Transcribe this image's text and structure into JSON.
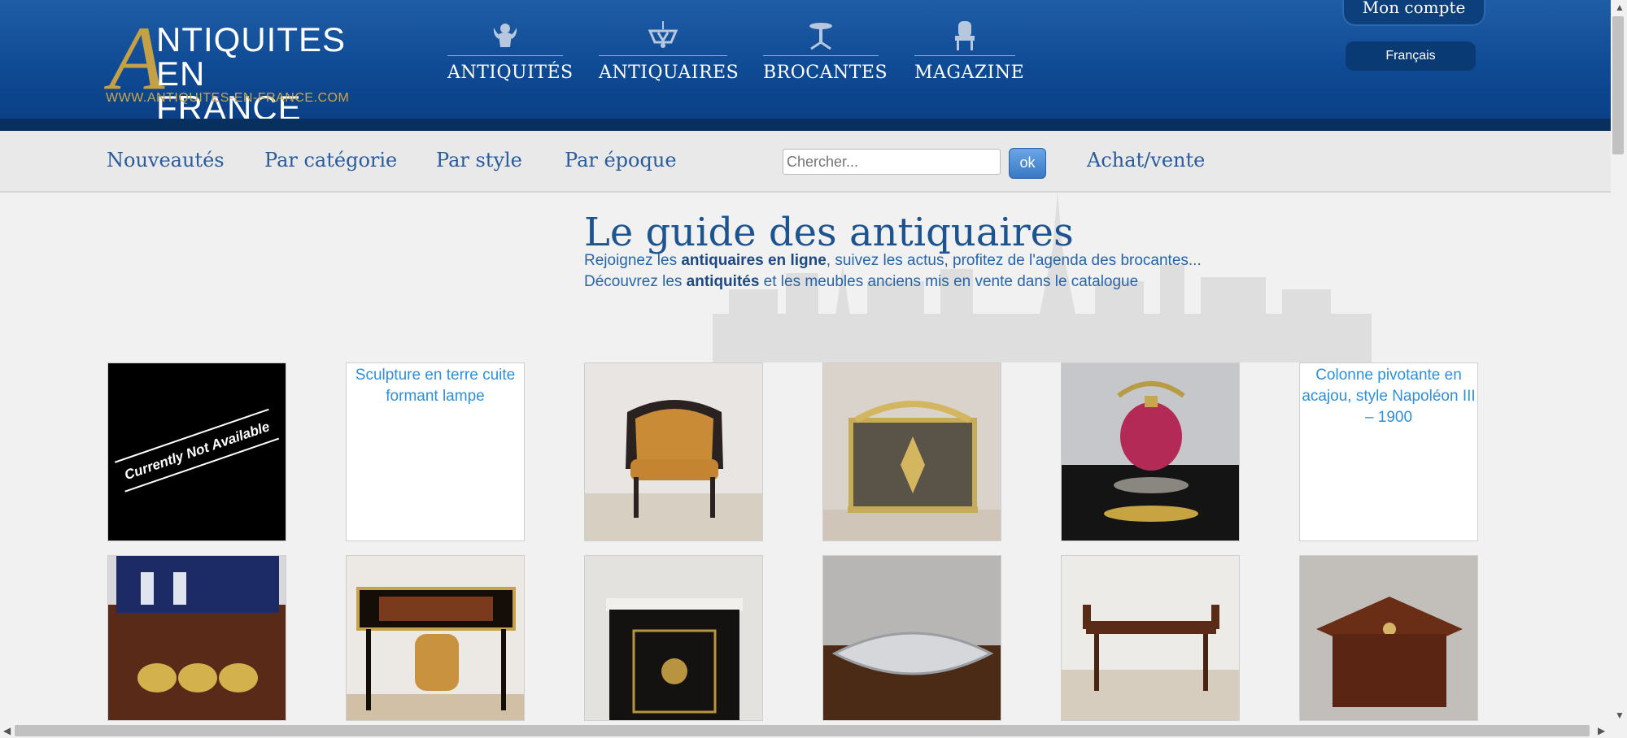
{
  "header": {
    "logo": {
      "line1": "NTIQUITES",
      "line2": "EN FRANCE",
      "big_letter": "A",
      "url": "WWW.ANTIQUITES-EN-FRANCE.COM"
    },
    "nav": [
      {
        "label": "ANTIQUITÉS",
        "icon": "cherub-icon"
      },
      {
        "label": "ANTIQUAIRES",
        "icon": "chandelier-icon"
      },
      {
        "label": "BROCANTES",
        "icon": "gueridon-table-icon"
      },
      {
        "label": "MAGAZINE",
        "icon": "armchair-icon"
      }
    ],
    "account": "Mon compte",
    "language": "Français"
  },
  "subnav": {
    "links": [
      "Nouveautés",
      "Par catégorie",
      "Par style",
      "Par époque"
    ],
    "search_placeholder": "Chercher...",
    "search_button": "ok",
    "achat": "Achat/vente"
  },
  "hero": {
    "title": "Le guide des antiquaires",
    "line1_pre": "Rejoignez les ",
    "line1_bold": "antiquaires en ligne",
    "line1_post": ", suivez les actus, profitez de l'agenda des brocantes...",
    "line2_pre": "Découvrez les ",
    "line2_bold": "antiquités",
    "line2_post": " et les meubles anciens mis en vente dans le catalogue"
  },
  "grid": {
    "row1": [
      {
        "kind": "not-available",
        "text": "Currently Not Available"
      },
      {
        "kind": "broken",
        "alt": "Sculpture en terre cuite formant lampe"
      },
      {
        "kind": "photo",
        "subject": "bergere-armchair"
      },
      {
        "kind": "photo",
        "subject": "fire-screen"
      },
      {
        "kind": "photo",
        "subject": "tea-kettle"
      },
      {
        "kind": "broken",
        "alt": "Colonne pivotante en acajou, style Napoléon III – 1900"
      }
    ],
    "row2": [
      {
        "kind": "photo",
        "subject": "liqueur-cellar"
      },
      {
        "kind": "photo",
        "subject": "bureau-plat"
      },
      {
        "kind": "photo",
        "subject": "boulle-cabinet"
      },
      {
        "kind": "photo",
        "subject": "silver-surtout"
      },
      {
        "kind": "photo",
        "subject": "bench"
      },
      {
        "kind": "photo",
        "subject": "side-table"
      }
    ]
  },
  "colors": {
    "header_blue": "#0e4a93",
    "link_blue": "#2a5b9b",
    "gold": "#c4a046"
  }
}
